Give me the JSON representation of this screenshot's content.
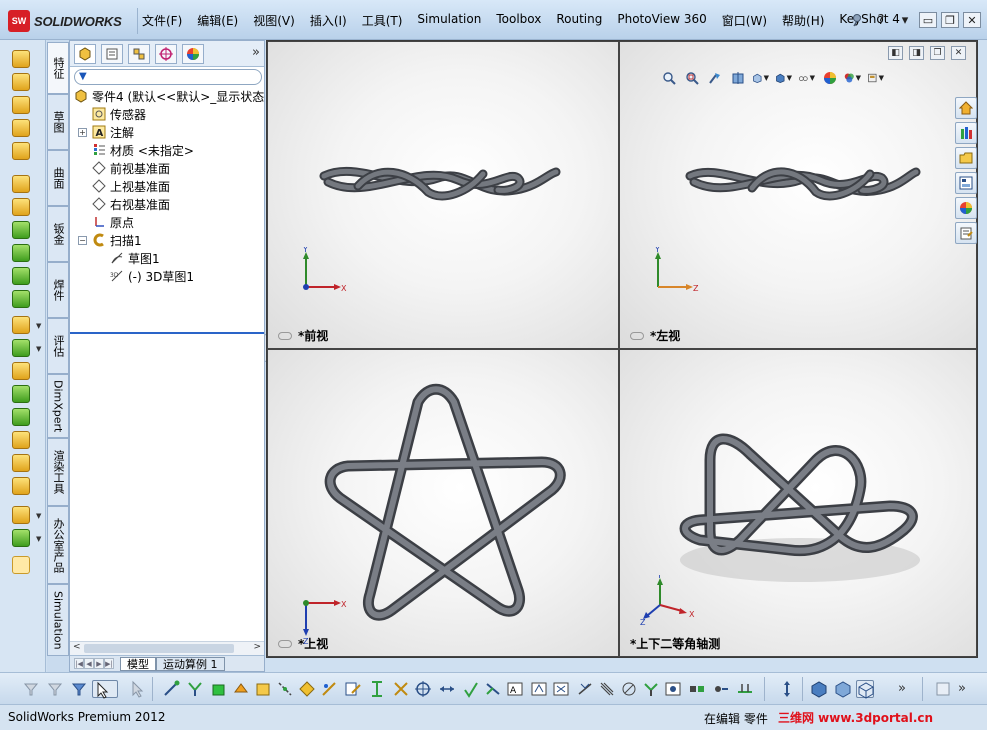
{
  "app": {
    "logo_mark": "SW",
    "logo_text": "SOLIDWORKS"
  },
  "menu": [
    "文件(F)",
    "编辑(E)",
    "视图(V)",
    "插入(I)",
    "工具(T)",
    "Simulation",
    "Toolbox",
    "Routing",
    "PhotoView 360",
    "窗口(W)",
    "帮助(H)",
    "KeyShot 4"
  ],
  "title_controls": {
    "pin": "pin-icon",
    "help": "?",
    "help_dropdown": "▾",
    "minimize": "▭",
    "restore": "❐",
    "close": "✕"
  },
  "vertical_tabs": [
    "特征",
    "草图",
    "曲面",
    "钣金",
    "焊件",
    "评估",
    "DimXpert",
    "渲染工具",
    "办公室产品",
    "Simulation"
  ],
  "feature_manager": {
    "tabs": [
      "feature-tree-icon",
      "property-manager-icon",
      "configuration-icon",
      "dimxpert-icon",
      "display-manager-icon"
    ],
    "more": "»",
    "filter_icon": "filter-icon",
    "tree": [
      {
        "label": "零件4  (默认<<默认>_显示状态",
        "icon": "part-icon",
        "level": 0
      },
      {
        "label": "传感器",
        "icon": "sensor-icon",
        "level": 1
      },
      {
        "label": "注解",
        "icon": "annotation-icon",
        "level": 1,
        "expander": "+"
      },
      {
        "label": "材质 <未指定>",
        "icon": "material-icon",
        "level": 1
      },
      {
        "label": "前视基准面",
        "icon": "plane-icon",
        "level": 1
      },
      {
        "label": "上视基准面",
        "icon": "plane-icon",
        "level": 1
      },
      {
        "label": "右视基准面",
        "icon": "plane-icon",
        "level": 1
      },
      {
        "label": "原点",
        "icon": "origin-icon",
        "level": 1
      },
      {
        "label": "扫描1",
        "icon": "sweep-icon",
        "level": 1,
        "expander": "−"
      },
      {
        "label": "草图1",
        "icon": "sketch-icon",
        "level": 2
      },
      {
        "label": "(-) 3D草图1",
        "icon": "3d-sketch-icon",
        "level": 2
      }
    ],
    "scroll_left": "<",
    "scroll_right": ">",
    "bottom_tabs": [
      "模型",
      "运动算例 1"
    ]
  },
  "viewports": {
    "front_label": "*前视",
    "left_label": "*左视",
    "top_label": "*上视",
    "iso_label": "*上下二等角轴测",
    "axis_x": "X",
    "axis_y": "Y",
    "axis_z": "Z"
  },
  "heads_up_toolbar": [
    "zoom-to-fit-icon",
    "zoom-to-area-icon",
    "previous-view-icon",
    "section-view-icon",
    "view-orientation-icon",
    "display-style-icon",
    "hide-show-icon",
    "edit-appearance-icon",
    "apply-scene-icon",
    "view-settings-icon"
  ],
  "task_pane": [
    "home-icon",
    "design-library-icon",
    "file-explorer-icon",
    "view-palette-icon",
    "appearances-icon",
    "custom-properties-icon"
  ],
  "status": {
    "product": "SolidWorks Premium 2012",
    "editing": "在编辑 零件",
    "watermark": "三维网 www.3dportal.cn"
  },
  "colors": {
    "accent": "#2a64c8",
    "knot": "#5a5d63",
    "axis_x": "#c0242a",
    "axis_y": "#2f8a2a",
    "axis_z": "#1f3fb0"
  }
}
